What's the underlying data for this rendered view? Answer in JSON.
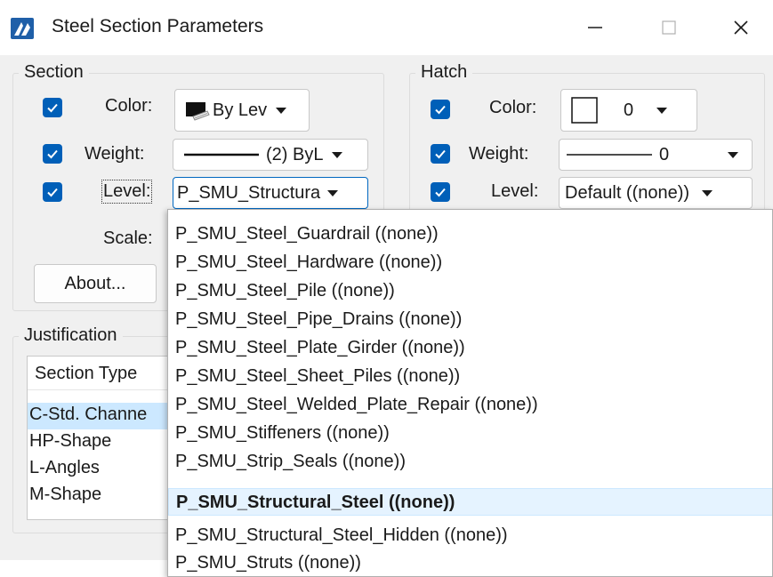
{
  "window": {
    "title": "Steel Section Parameters",
    "controls": [
      "minimize-icon",
      "maximize-icon",
      "close-icon"
    ]
  },
  "section": {
    "legend": "Section",
    "color_label": "Color:",
    "color_value": "By Lev",
    "color_checked": true,
    "weight_label": "Weight:",
    "weight_value": "(2) ByL",
    "weight_checked": true,
    "level_label": "Level:",
    "level_value": "P_SMU_Structura",
    "level_checked": true,
    "scale_label": "Scale:",
    "about_label": "About..."
  },
  "hatch": {
    "legend": "Hatch",
    "color_label": "Color:",
    "color_value": "0",
    "color_checked": true,
    "weight_label": "Weight:",
    "weight_value": "0",
    "weight_checked": true,
    "level_label": "Level:",
    "level_value": "Default ((none))",
    "level_checked": true
  },
  "justification": {
    "legend": "Justification",
    "column_header": "Section Type",
    "rows": [
      "C-Std. Channe",
      "HP-Shape",
      "L-Angles",
      "M-Shape"
    ],
    "selected_index": 0
  },
  "level_dropdown": {
    "items": [
      "P_SMU_Steel_Guardrail ((none))",
      "P_SMU_Steel_Hardware ((none))",
      "P_SMU_Steel_Pile ((none))",
      "P_SMU_Steel_Pipe_Drains ((none))",
      "P_SMU_Steel_Plate_Girder ((none))",
      "P_SMU_Steel_Sheet_Piles ((none))",
      "P_SMU_Steel_Welded_Plate_Repair ((none))",
      "P_SMU_Stiffeners ((none))",
      "P_SMU_Strip_Seals ((none))",
      "P_SMU_Structural_Steel ((none))",
      "P_SMU_Structural_Steel_Hidden ((none))",
      "P_SMU_Struts ((none))"
    ],
    "highlighted_index": 9
  },
  "colors": {
    "accent": "#005fb8",
    "selection": "#cce8ff",
    "hover": "#e5f3ff",
    "dialog_bg": "#f0f0f0"
  }
}
